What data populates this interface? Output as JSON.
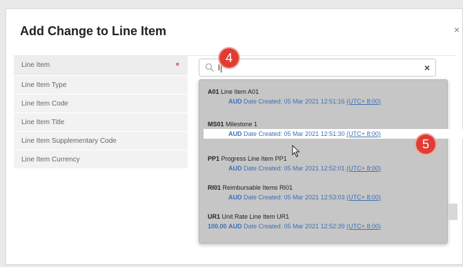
{
  "modal": {
    "title": "Add Change to Line Item",
    "close_label": "×"
  },
  "form": {
    "fields": [
      {
        "label": "Line Item",
        "required": true
      },
      {
        "label": "Line Item Type"
      },
      {
        "label": "Line Item Code"
      },
      {
        "label": "Line Item Title"
      },
      {
        "label": "Line Item Supplementary Code"
      },
      {
        "label": "Line Item Currency"
      }
    ],
    "required_marker": "*"
  },
  "search": {
    "value": "l",
    "clear_label": "×"
  },
  "dropdown": {
    "items": [
      {
        "code": "A01",
        "title": "Line Item A01",
        "amount": "",
        "currency": "AUD",
        "date_text": "Date Created: 05 Mar 2021 12:51:16",
        "tz": "(UTC+ 8:00)"
      },
      {
        "code": "MS01",
        "title": "Milestone 1",
        "amount": "",
        "currency": "AUD",
        "date_text": "Date Created: 05 Mar 2021 12:51:30",
        "tz": "(UTC+ 8:00)",
        "hover": true
      },
      {
        "code": "PP1",
        "title": "Progress Line Item PP1",
        "amount": "",
        "currency": "AUD",
        "date_text": "Date Created: 05 Mar 2021 12:52:01",
        "tz": "(UTC+ 8:00)"
      },
      {
        "code": "RI01",
        "title": "Reimbursable Items RI01",
        "amount": "",
        "currency": "AUD",
        "date_text": "Date Created: 05 Mar 2021 12:53:03",
        "tz": "(UTC+ 8:00)"
      },
      {
        "code": "UR1",
        "title": "Unit Rate Line Item UR1",
        "amount": "100.00",
        "currency": "AUD",
        "date_text": "Date Created: 05 Mar 2021 12:52:39",
        "tz": "(UTC+ 8:00)"
      }
    ]
  },
  "callouts": {
    "step_a": "4",
    "step_b": "5"
  },
  "colors": {
    "accent_blue": "#3d6fb5",
    "required_red": "#c9252b",
    "callout_red": "#e03c34"
  }
}
